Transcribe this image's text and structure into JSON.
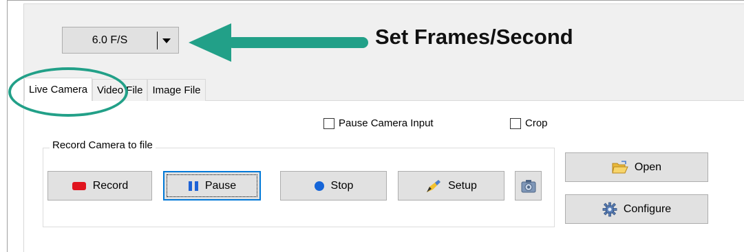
{
  "fps": {
    "value": "6.0 F/S"
  },
  "annotation": {
    "text": "Set Frames/Second",
    "color": "#22a088"
  },
  "tabs": [
    {
      "label": "Live Camera",
      "active": true
    },
    {
      "label": "Video File",
      "active": false
    },
    {
      "label": "Image File",
      "active": false
    }
  ],
  "options": {
    "pause_camera_input": {
      "label": "Pause Camera Input",
      "checked": false
    },
    "crop": {
      "label": "Crop",
      "checked": false
    }
  },
  "record_group": {
    "title": "Record Camera to file",
    "buttons": {
      "record": "Record",
      "pause": "Pause",
      "stop": "Stop",
      "setup": "Setup"
    }
  },
  "side_buttons": {
    "open": "Open",
    "configure": "Configure"
  },
  "colors": {
    "record_red": "#e0141e",
    "pause_blue": "#1e63d6",
    "stop_blue": "#1565d8",
    "focus_border": "#0078d7"
  },
  "icons": {
    "fps_dropdown": "chevron-down-icon",
    "record": "record-icon",
    "pause": "pause-icon",
    "stop": "stop-icon",
    "setup": "setup-pen-icon",
    "snapshot": "camera-icon",
    "open": "folder-open-icon",
    "configure": "gear-icon"
  }
}
